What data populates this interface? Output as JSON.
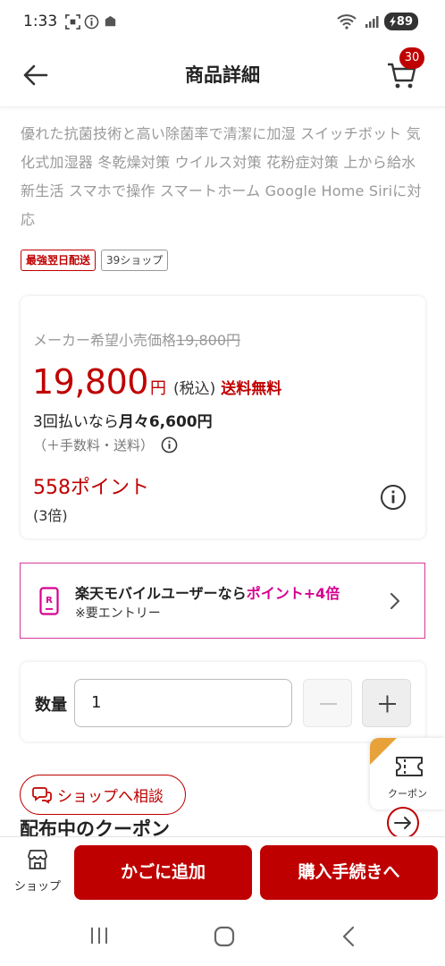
{
  "status_bar": {
    "time": "1:33",
    "battery": "89",
    "icons": [
      "screenshot-icon",
      "info-icon",
      "app-icon",
      "wifi-icon",
      "signal-icon",
      "battery-icon"
    ]
  },
  "header": {
    "title": "商品詳細",
    "cart_count": "30"
  },
  "description": "優れた抗菌技術と高い除菌率で清潔に加湿 スイッチボット 気化式加湿器 冬乾燥対策 ウイルス対策 花粉症対策 上から給水 新生活 スマホで操作 スマートホーム Google Home Siriに対応",
  "tags": {
    "delivery": "最強翌日配送",
    "shop39": "39ショップ"
  },
  "price": {
    "msrp_label": "メーカー希望小売価格",
    "msrp_value": "19,800円",
    "amount": "19,800",
    "yen": "円",
    "tax": "(税込)",
    "shipping": "送料無料",
    "installment_prefix": "3回払いなら",
    "installment_value": "月々6,600円",
    "fees": "（＋手数料・送料）",
    "points": "558ポイント",
    "multiplier": "(3倍)"
  },
  "promo": {
    "line1_prefix": "楽天モバイルユーザーなら",
    "line1_highlight": "ポイント+4倍",
    "line2": "※要エントリー"
  },
  "quantity": {
    "label": "数量",
    "value": "1"
  },
  "coupon_tab": {
    "label": "クーポン"
  },
  "consult_label": "ショップへ相談",
  "coupon_heading": "配布中のクーポン",
  "bottom_bar": {
    "shop_label": "ショップ",
    "add_to_cart": "かごに追加",
    "checkout": "購入手続きへ"
  },
  "colors": {
    "rakuten_red": "#bf0000",
    "promo_pink": "#d6008f",
    "coupon_corner": "#e8a23a"
  }
}
